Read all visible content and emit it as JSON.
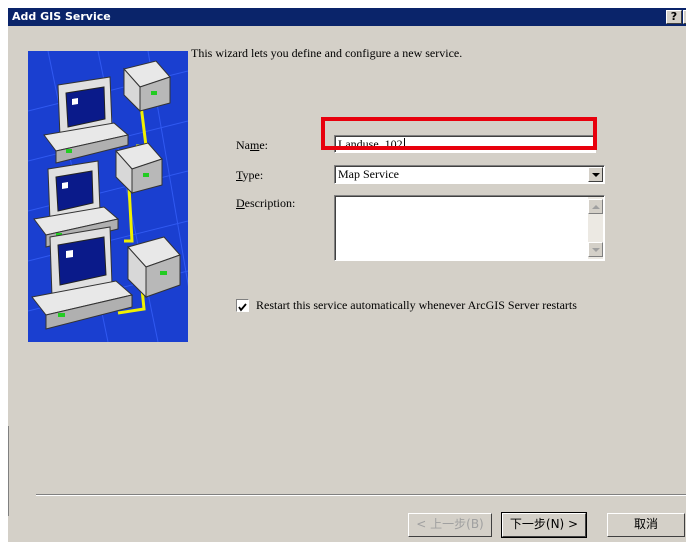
{
  "window": {
    "title": "Add GIS Service",
    "help_label": "?",
    "close_label": "✕"
  },
  "intro_text": "This wizard lets you define and configure a new service.",
  "form": {
    "name": {
      "label_pre": "Na",
      "label_accel": "m",
      "label_post": "e:",
      "value": "Landuse_102"
    },
    "type": {
      "label_accel": "T",
      "label_post": "ype:",
      "value": "Map Service"
    },
    "description": {
      "label_accel": "D",
      "label_post": "escription:",
      "value": ""
    },
    "restart": {
      "checked": true,
      "label": "Restart this service automatically whenever ArcGIS Server restarts"
    }
  },
  "buttons": {
    "back": "< 上一步(B)",
    "next": "下一步(N) >",
    "cancel": "取消"
  },
  "colors": {
    "titlebar": "#0a246a",
    "dialog_bg": "#d4d0c8",
    "highlight": "#e8000d",
    "illustration_bg": "#1a3fd0"
  },
  "icons": {
    "illustration": "networked-computers-illustration"
  }
}
